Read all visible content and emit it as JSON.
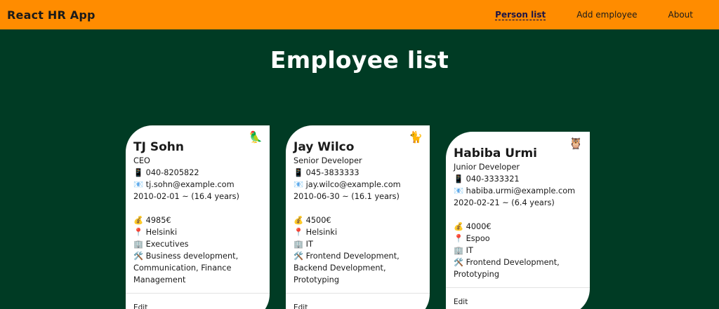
{
  "header": {
    "brand": "React HR App",
    "nav": [
      {
        "label": "Person list",
        "active": true
      },
      {
        "label": "Add employee",
        "active": false
      },
      {
        "label": "About",
        "active": false
      }
    ],
    "accent_color": "#ff8c00",
    "background_color": "#003b24"
  },
  "main": {
    "title": "Employee list",
    "employees": [
      {
        "avatar": "🦜",
        "name": "TJ Sohn",
        "role": "CEO",
        "phone": "📱 040-8205822",
        "email": "📧 tj.sohn@example.com",
        "tenure": "2010-02-01 ~ (16.4 years)",
        "salary": "💰 4985€",
        "location": "📍 Helsinki",
        "department": "🏢 Executives",
        "skills": "🛠️ Business development, Communication, Finance Management",
        "edit_label": "Edit"
      },
      {
        "avatar": "🐈",
        "name": "Jay Wilco",
        "role": "Senior Developer",
        "phone": "📱 045-3833333",
        "email": "📧 jay.wilco@example.com",
        "tenure": "2010-06-30 ~ (16.1 years)",
        "salary": "💰 4500€",
        "location": "📍 Helsinki",
        "department": "🏢 IT",
        "skills": "🛠️ Frontend Development, Backend Development, Prototyping",
        "edit_label": "Edit"
      },
      {
        "avatar": "🦉",
        "name": "Habiba Urmi",
        "role": "Junior Developer",
        "phone": "📱 040-3333321",
        "email": "📧 habiba.urmi@example.com",
        "tenure": "2020-02-21 ~ (6.4 years)",
        "salary": "💰 4000€",
        "location": "📍 Espoo",
        "department": "🏢 IT",
        "skills": "🛠️ Frontend Development, Prototyping",
        "edit_label": "Edit"
      }
    ]
  }
}
